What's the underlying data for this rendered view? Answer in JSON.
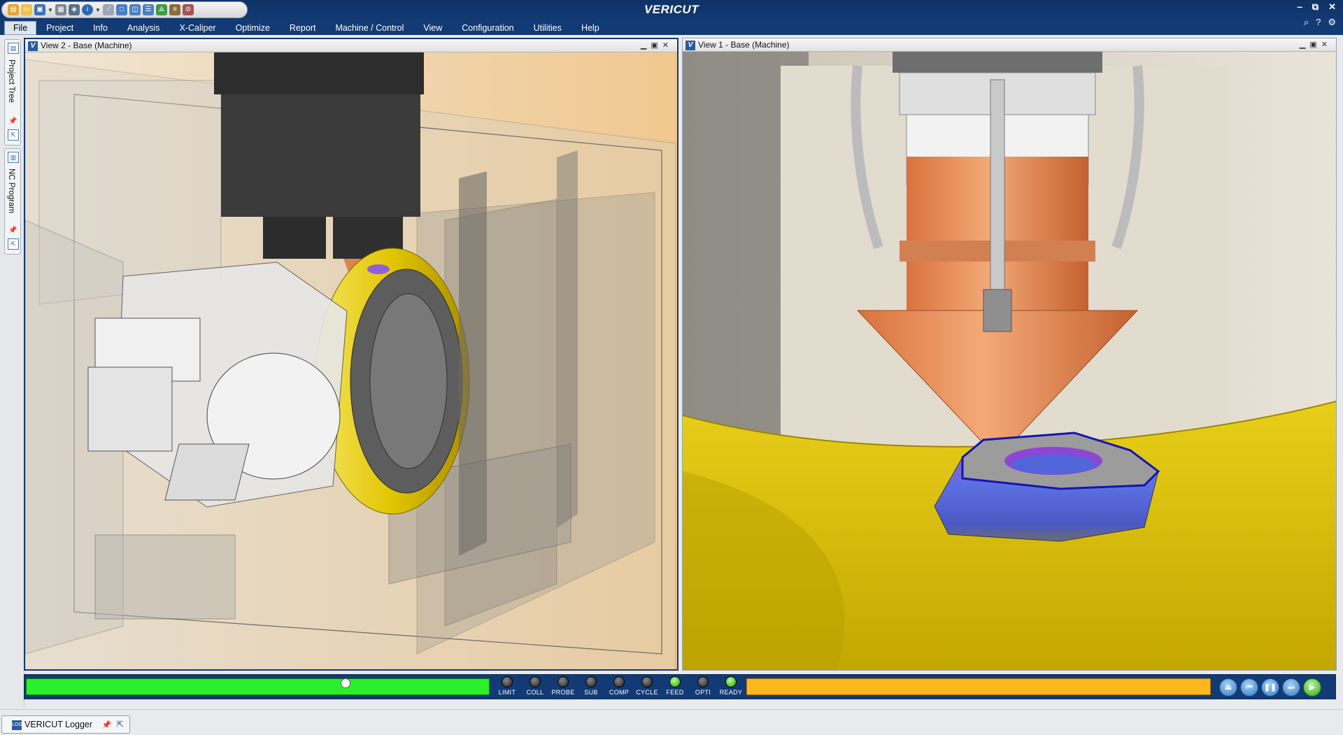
{
  "app": {
    "title": "VERICUT"
  },
  "quick_access": {
    "icons": [
      "open-folder-icon",
      "folder-icon",
      "save-icon",
      "chevron-down-icon",
      "grid-icon",
      "model-icon",
      "info-icon",
      "chevron-down-icon",
      "ruler-icon",
      "window-icon",
      "layout-icon",
      "split-icon",
      "graph-icon",
      "report-icon",
      "shield-icon"
    ]
  },
  "window_controls": {
    "minimize": "‒",
    "restore": "⧉",
    "close": "✕"
  },
  "right_tools": [
    "search-icon",
    "help-icon",
    "settings-icon"
  ],
  "menu": {
    "items": [
      "File",
      "Project",
      "Info",
      "Analysis",
      "X-Caliper",
      "Optimize",
      "Report",
      "Machine / Control",
      "View",
      "Configuration",
      "Utilities",
      "Help"
    ],
    "active": "File"
  },
  "sidebar": {
    "tabs": [
      {
        "label": "Project Tree"
      },
      {
        "label": "NC Program"
      }
    ]
  },
  "views": [
    {
      "title": "View 2 - Base (Machine)",
      "active": true
    },
    {
      "title": "View 1 - Base (Machine)",
      "active": false
    }
  ],
  "status": {
    "progress_left_fraction": 1.0,
    "slider_position_fraction": 0.69,
    "progress_right_fraction": 1.0,
    "indicators": [
      {
        "label": "LIMIT",
        "on": false
      },
      {
        "label": "COLL",
        "on": false
      },
      {
        "label": "PROBE",
        "on": false
      },
      {
        "label": "SUB",
        "on": false
      },
      {
        "label": "COMP",
        "on": false
      },
      {
        "label": "CYCLE",
        "on": false
      },
      {
        "label": "FEED",
        "on": true
      },
      {
        "label": "OPTI",
        "on": false
      },
      {
        "label": "READY",
        "on": true
      }
    ],
    "playback": [
      "eject-icon",
      "rewind-icon",
      "pause-icon",
      "step-icon",
      "play-icon"
    ],
    "colors": {
      "progress_left": "#29f02a",
      "progress_right": "#fdb71d",
      "frame": "#123a74"
    }
  },
  "footer": {
    "logger_label": "VERICUT Logger"
  }
}
